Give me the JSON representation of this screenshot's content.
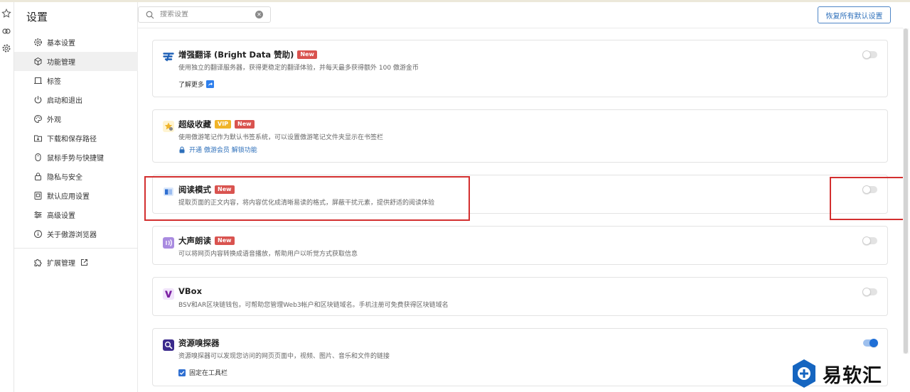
{
  "sidebar": {
    "title": "设置",
    "items": [
      {
        "label": "基本设置",
        "icon": "gear-icon"
      },
      {
        "label": "功能管理",
        "icon": "cube-icon",
        "active": true
      },
      {
        "label": "标签",
        "icon": "tab-icon"
      },
      {
        "label": "启动和退出",
        "icon": "power-icon"
      },
      {
        "label": "外观",
        "icon": "palette-icon"
      },
      {
        "label": "下载和保存路径",
        "icon": "download-folder-icon"
      },
      {
        "label": "鼠标手势与快捷键",
        "icon": "mouse-icon"
      },
      {
        "label": "隐私与安全",
        "icon": "lock-icon"
      },
      {
        "label": "默认应用设置",
        "icon": "default-app-icon"
      },
      {
        "label": "高级设置",
        "icon": "sliders-icon"
      },
      {
        "label": "关于傲游浏览器",
        "icon": "info-icon"
      }
    ],
    "extensions": {
      "label": "扩展管理",
      "icon": "puzzle-icon",
      "external_icon": "external-link-icon"
    }
  },
  "search": {
    "placeholder": "搜索设置",
    "value": ""
  },
  "header": {
    "reset_label": "恢复所有默认设置"
  },
  "cards": [
    {
      "title": "增强翻译 (Bright Data 赞助)",
      "badges": [
        "New"
      ],
      "desc": "使用独立的翻译服务器，获得更稳定的翻译体验，并每天最多获得额外 100 傲游金币",
      "extra": "了解更多",
      "toggle": false,
      "icon": "translate-icon"
    },
    {
      "title": "超级收藏",
      "badges": [
        "VIP",
        "New"
      ],
      "desc": "使用傲游笔记作为默认书签系统，可以设置傲游笔记文件夹显示在书签栏",
      "extra": "开通 傲游会员 解锁功能",
      "icon": "favorites-icon"
    },
    {
      "title": "阅读模式",
      "badges": [
        "New"
      ],
      "desc": "提取页面的正文内容，将内容优化成清晰易读的格式，屏蔽干扰元素，提供舒适的阅读体验",
      "toggle": false,
      "icon": "reader-icon"
    },
    {
      "title": "大声朗读",
      "badges": [
        "New"
      ],
      "desc": "可以将网页内容转换成语音播放，帮助用户以听觉方式获取信息",
      "toggle": false,
      "icon": "read-aloud-icon"
    },
    {
      "title": "VBox",
      "badges": [],
      "desc": "BSV和AR区块链钱包，可帮助您管理Web3帐户和区块链域名。手机注册可免费获得区块链域名",
      "toggle": false,
      "icon": "vbox-icon"
    },
    {
      "title": "资源嗅探器",
      "badges": [],
      "desc": "资源嗅探器可以发现您访问的网页页面中，视频、图片、音乐和文件的链接",
      "extra": "固定在工具栏",
      "extra_checked": true,
      "toggle": true,
      "icon": "sniffer-icon"
    }
  ],
  "watermark": {
    "text": "易软汇"
  },
  "colors": {
    "accent": "#1f6fd6",
    "badge_new": "#d9534f",
    "badge_vip": "#f0b429",
    "highlight": "#d32f2f"
  }
}
